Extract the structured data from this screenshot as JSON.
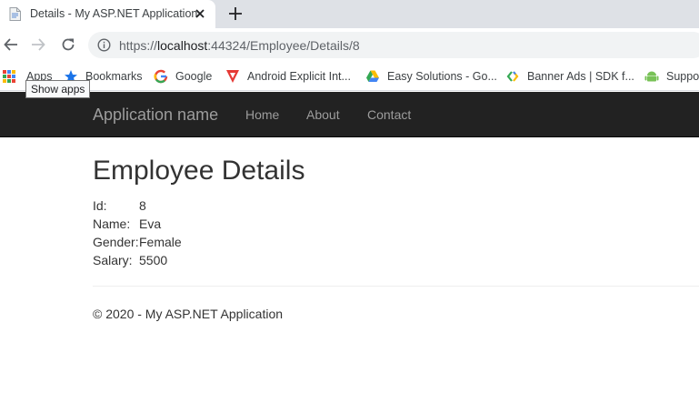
{
  "browser": {
    "tab": {
      "title": "Details - My ASP.NET Application"
    },
    "url": {
      "scheme": "https://",
      "host": "localhost",
      "rest": ":44324/Employee/Details/8"
    },
    "bookmarks": [
      {
        "label": "Apps",
        "icon": "apps-grid-icon"
      },
      {
        "label": "Bookmarks",
        "icon": "star-icon"
      },
      {
        "label": "Google",
        "icon": "google-icon"
      },
      {
        "label": "Android Explicit Int...",
        "icon": "red-v-icon"
      },
      {
        "label": "Easy Solutions - Go...",
        "icon": "drive-icon"
      },
      {
        "label": "Banner Ads  |  SDK f...",
        "icon": "ads-icon"
      },
      {
        "label": "Suppo",
        "icon": "android-icon"
      }
    ],
    "tooltip": "Show apps"
  },
  "site": {
    "brand": "Application name",
    "nav": [
      "Home",
      "About",
      "Contact"
    ],
    "title": "Employee Details",
    "fields": [
      {
        "label": "Id:",
        "value": "8"
      },
      {
        "label": "Name:",
        "value": "Eva"
      },
      {
        "label": "Gender:",
        "value": "Female"
      },
      {
        "label": "Salary:",
        "value": "5500"
      }
    ],
    "footer": "© 2020 - My ASP.NET Application"
  },
  "colors": {
    "navbar": "#222222",
    "nav_text": "#9d9d9d",
    "tabstrip": "#dee1e6",
    "omnibox": "#f1f3f4"
  }
}
